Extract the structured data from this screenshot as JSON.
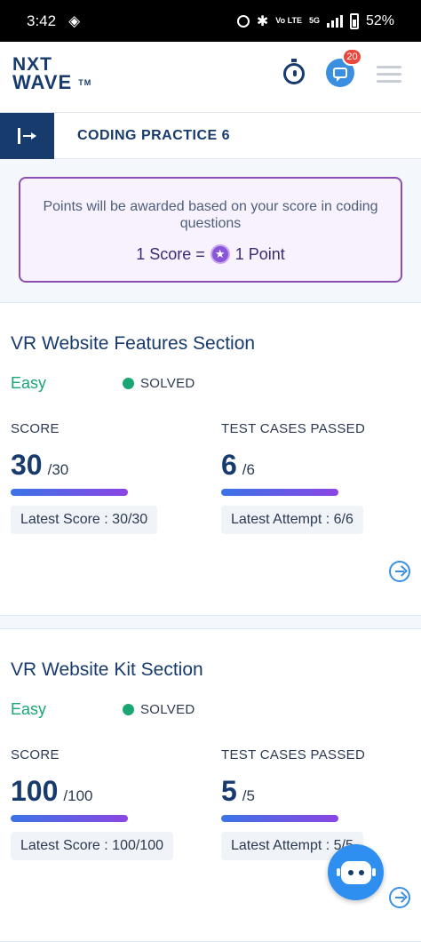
{
  "status_bar": {
    "time": "3:42",
    "battery": "52%",
    "network": "5G",
    "volte": "Vo LTE"
  },
  "header": {
    "logo_line1": "NXT",
    "logo_line2": "WAVE",
    "logo_tm": "TM",
    "chat_badge_count": "20"
  },
  "subheader": {
    "title": "CODING PRACTICE 6"
  },
  "info": {
    "text": "Points will be awarded based on your score in coding questions",
    "score_label": "1 Score =",
    "point_label": "1 Point",
    "coin_icon": "star"
  },
  "questions": [
    {
      "title": "VR Website Features Section",
      "difficulty": "Easy",
      "status": "SOLVED",
      "score_label": "SCORE",
      "score": "30",
      "score_total": "/30",
      "latest_score": "Latest Score : 30/30",
      "tests_label": "TEST CASES PASSED",
      "tests": "6",
      "tests_total": "/6",
      "latest_attempt": "Latest Attempt : 6/6",
      "score_progress": 1.0,
      "tests_progress": 1.0
    },
    {
      "title": "VR Website Kit Section",
      "difficulty": "Easy",
      "status": "SOLVED",
      "score_label": "SCORE",
      "score": "100",
      "score_total": "/100",
      "latest_score": "Latest Score : 100/100",
      "tests_label": "TEST CASES PASSED",
      "tests": "5",
      "tests_total": "/5",
      "latest_attempt": "Latest Attempt : 5/5",
      "score_progress": 1.0,
      "tests_progress": 1.0
    }
  ],
  "colors": {
    "primary": "#183b6e",
    "accent": "#3b8fe0",
    "easy": "#1aa673",
    "purple": "#8a4fb0",
    "badge": "#e8493f"
  }
}
